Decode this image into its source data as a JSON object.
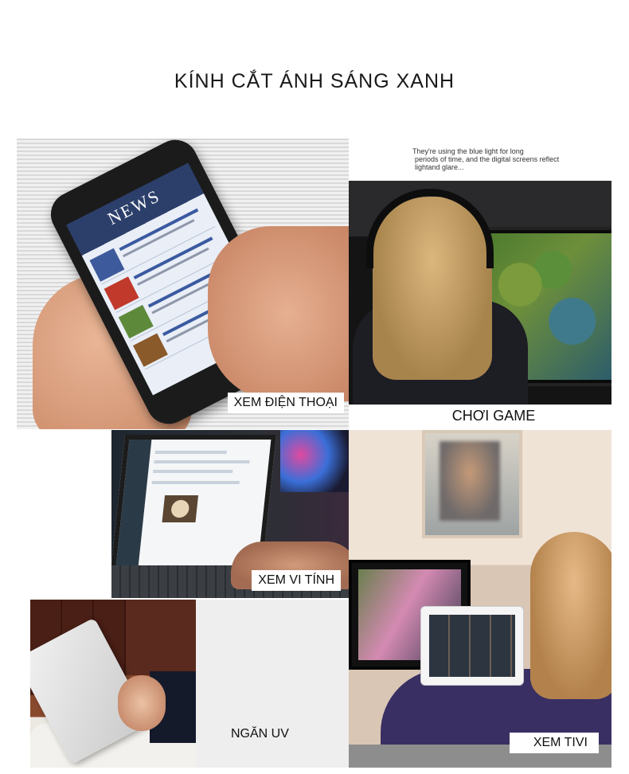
{
  "title": "KÍNH CẮT ÁNH SÁNG XANH",
  "tiles": {
    "phone": {
      "label": "XEM ĐIỆN THOẠI",
      "screen_heading": "NEWS"
    },
    "game": {
      "caption_lines": [
        "They're using the blue light for long",
        "periods of time, and the digital screens reflect",
        "lightand glare..."
      ],
      "label": "CHƠI GAME"
    },
    "laptop": {
      "label": "XEM VI TÍNH"
    },
    "tv": {
      "label": "XEM TIVI"
    },
    "uv": {
      "label": "NGĂN UV"
    }
  },
  "colors": {
    "background": "#ffffff",
    "label_bg": "#ffffff",
    "uv_panel": "#eeeeee"
  }
}
